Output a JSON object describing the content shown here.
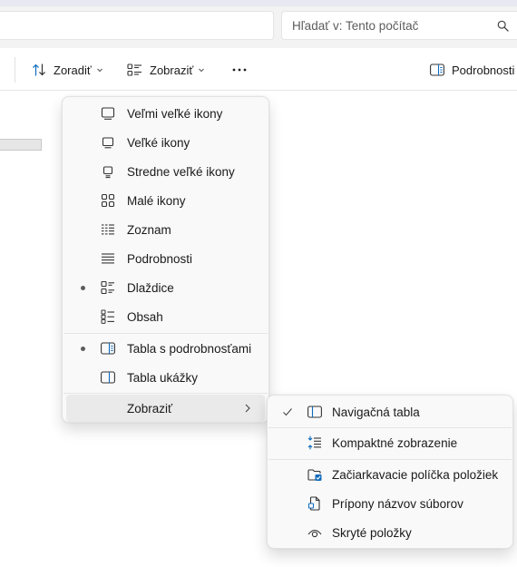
{
  "search": {
    "placeholder": "Hľadať v: Tento počítač"
  },
  "toolbar": {
    "sort_label": "Zoradiť",
    "view_label": "Zobraziť",
    "details_label": "Podrobnosti"
  },
  "view_menu": {
    "items": [
      {
        "label": "Veľmi veľké ikony",
        "icon": "extra-large-icons-icon",
        "selected": false
      },
      {
        "label": "Veľké ikony",
        "icon": "large-icons-icon",
        "selected": false
      },
      {
        "label": "Stredne veľké ikony",
        "icon": "medium-icons-icon",
        "selected": false
      },
      {
        "label": "Malé ikony",
        "icon": "small-icons-icon",
        "selected": false
      },
      {
        "label": "Zoznam",
        "icon": "list-icon",
        "selected": false
      },
      {
        "label": "Podrobnosti",
        "icon": "details-icon",
        "selected": false
      },
      {
        "label": "Dlaždice",
        "icon": "tiles-icon",
        "selected": true
      },
      {
        "label": "Obsah",
        "icon": "content-icon",
        "selected": false
      }
    ],
    "panes": [
      {
        "label": "Tabla s podrobnosťami",
        "icon": "details-pane-icon",
        "selected": true
      },
      {
        "label": "Tabla ukážky",
        "icon": "preview-pane-icon",
        "selected": false
      }
    ],
    "show_label": "Zobraziť"
  },
  "show_submenu": {
    "items": [
      {
        "label": "Navigačná tabla",
        "icon": "navigation-pane-icon",
        "checked": true
      },
      {
        "label": "Kompaktné zobrazenie",
        "icon": "compact-view-icon",
        "checked": false
      },
      {
        "label": "Začiarkavacie políčka položiek",
        "icon": "item-checkboxes-icon",
        "checked": false
      },
      {
        "label": "Prípony názvov súborov",
        "icon": "file-extensions-icon",
        "checked": false
      },
      {
        "label": "Skryté položky",
        "icon": "hidden-items-icon",
        "checked": false
      }
    ]
  },
  "colors": {
    "accent": "#0f6cbd",
    "menu_bg": "#f9f9f9",
    "hover_bg": "#eaeaea"
  }
}
